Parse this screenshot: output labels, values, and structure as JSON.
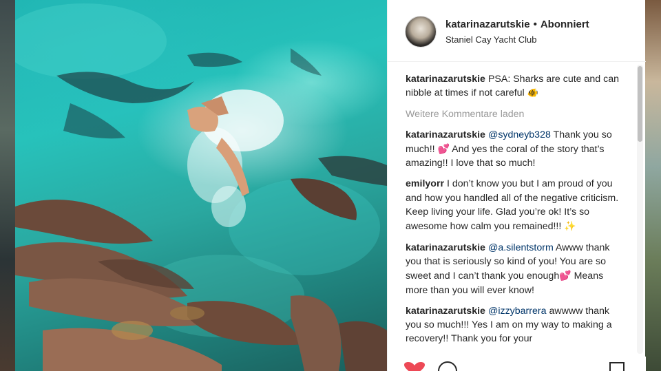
{
  "post": {
    "header": {
      "username": "katarinazarutskie",
      "separator": "•",
      "follow_status": "Abonniert",
      "location": "Staniel Cay Yacht Club"
    },
    "caption": {
      "username": "katarinazarutskie",
      "text": "PSA: Sharks are cute and can nibble at times if not careful",
      "emoji": "🐠"
    },
    "load_more_label": "Weitere Kommentare laden",
    "comments": [
      {
        "username": "katarinazarutskie",
        "mention": "@sydneyb328",
        "text_a": " Thank you so much!! ",
        "emoji": "💕",
        "text_b": " And yes the coral of the story that’s amazing!! I love that so much!"
      },
      {
        "username": "emilyorr",
        "text_a": "I don’t know you but I am proud of you and how you handled all of the negative criticism. Keep living your life. Glad you’re ok! It’s so awesome how calm you remained!!! ",
        "emoji": "✨"
      },
      {
        "username": "katarinazarutskie",
        "mention": "@a.silentstorm",
        "text_a": " Awww thank you that is seriously so kind of you! You are so sweet and I can’t thank you enough",
        "emoji": "💕",
        "text_b": " Means more than you will ever know!"
      },
      {
        "username": "katarinazarutskie",
        "mention": "@izzybarrera",
        "text_a": " awwww thank you so much!!! Yes I am on my way to making a recovery!! Thank you for your"
      }
    ],
    "icons": {
      "like": "heart-icon",
      "comment": "comment-icon",
      "save": "bookmark-icon",
      "like_color": "#ed4956"
    },
    "photo_alt": "nurse sharks in turquoise water"
  }
}
